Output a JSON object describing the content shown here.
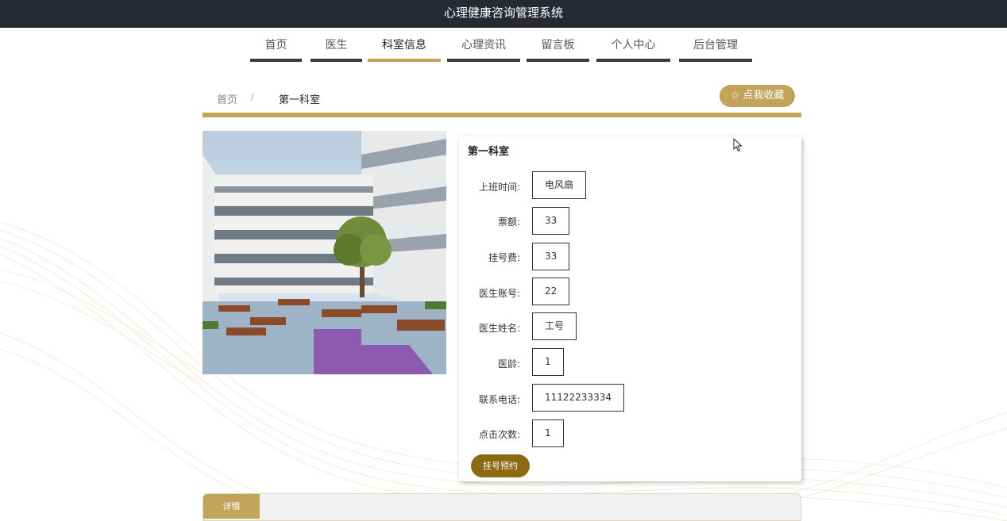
{
  "header": {
    "title": "心理健康咨询管理系统"
  },
  "nav": {
    "items": [
      {
        "label": "首页"
      },
      {
        "label": "医生"
      },
      {
        "label": "科室信息"
      },
      {
        "label": "心理资讯"
      },
      {
        "label": "留言板"
      },
      {
        "label": "个人中心"
      },
      {
        "label": "后台管理"
      }
    ],
    "active_index": 2
  },
  "breadcrumb": {
    "home": "首页",
    "separator": "/",
    "current": "第一科室"
  },
  "favorite_button": {
    "label": "☆ 点我收藏"
  },
  "detail": {
    "title": "第一科室",
    "fields": [
      {
        "label": "上班时间:",
        "value": "电风扇"
      },
      {
        "label": "票额:",
        "value": "33"
      },
      {
        "label": "挂号费:",
        "value": "33"
      },
      {
        "label": "医生账号:",
        "value": "22"
      },
      {
        "label": "医生姓名:",
        "value": "工号"
      },
      {
        "label": "医龄:",
        "value": "1"
      },
      {
        "label": "联系电话:",
        "value": "11122233334"
      },
      {
        "label": "点击次数:",
        "value": "1"
      }
    ],
    "book_button": "挂号预约"
  },
  "tabs": {
    "detail_label": "详情"
  },
  "colors": {
    "accent": "#c2a35a",
    "topbar": "#272a33",
    "book_button": "#8b6a12"
  }
}
